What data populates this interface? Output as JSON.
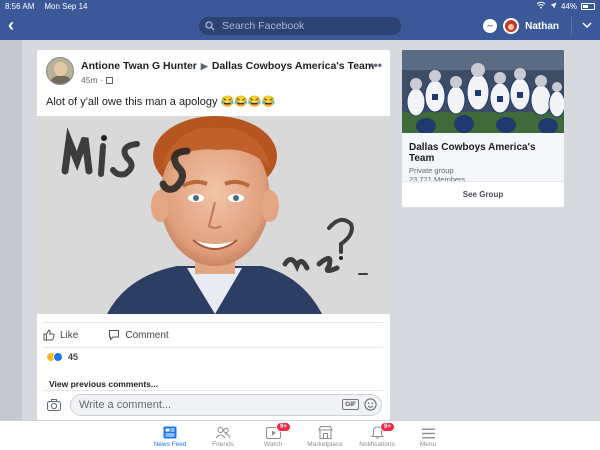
{
  "status_bar": {
    "time": "8:56 AM",
    "date": "Mon Sep 14",
    "battery": "44%"
  },
  "nav": {
    "search_placeholder": "Search Facebook",
    "user_name": "Nathan"
  },
  "post": {
    "author": "Antione Twan G Hunter",
    "group": "Dallas Cowboys America's Team",
    "time": "45m",
    "text": "Alot of y'all owe this man a apology 😂😂😂😂",
    "photo_text_1": "Miss",
    "photo_text_2": "me?",
    "actions": {
      "like": "Like",
      "comment": "Comment"
    },
    "reaction_count": "45",
    "view_previous": "View previous comments...",
    "comment_placeholder": "Write a comment...",
    "gif_label": "GIF"
  },
  "group_card": {
    "name": "Dallas Cowboys America's Team",
    "privacy": "Private group",
    "members": "23,721 Members",
    "button": "See Group"
  },
  "tabs": [
    {
      "label": "News Feed",
      "icon": "news-feed-icon",
      "badge": ""
    },
    {
      "label": "Friends",
      "icon": "friends-icon",
      "badge": ""
    },
    {
      "label": "Watch",
      "icon": "watch-icon",
      "badge": "9+"
    },
    {
      "label": "Marketplace",
      "icon": "marketplace-icon",
      "badge": ""
    },
    {
      "label": "Notifications",
      "icon": "bell-icon",
      "badge": "9+"
    },
    {
      "label": "Menu",
      "icon": "menu-icon",
      "badge": ""
    }
  ],
  "colors": {
    "brand": "#3b5998",
    "active_tab": "#1877f2",
    "badge": "#f02849"
  }
}
